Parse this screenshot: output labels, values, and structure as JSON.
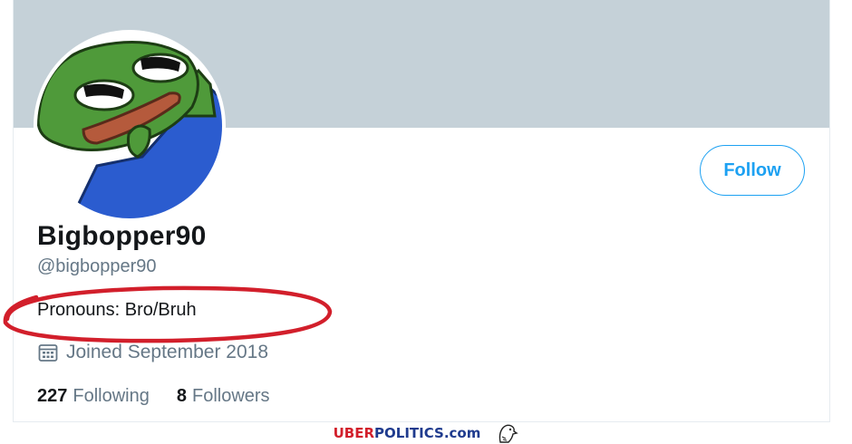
{
  "profile": {
    "display_name": "Bigbopper90",
    "handle": "@bigbopper90",
    "bio": "Pronouns: Bro/Bruh",
    "joined": "Joined September 2018",
    "follow_label": "Follow"
  },
  "stats": [
    {
      "count": "227",
      "label": "Following"
    },
    {
      "count": "8",
      "label": "Followers"
    }
  ],
  "colors": {
    "banner": "#c5d1d8",
    "accent": "#1da1f2",
    "annotation": "#d21f2b"
  },
  "icons": {
    "calendar": "calendar-icon"
  },
  "footer": {
    "brand_part1": "UBER",
    "brand_part2": "POLITICS",
    "brand_part3": ".com"
  }
}
